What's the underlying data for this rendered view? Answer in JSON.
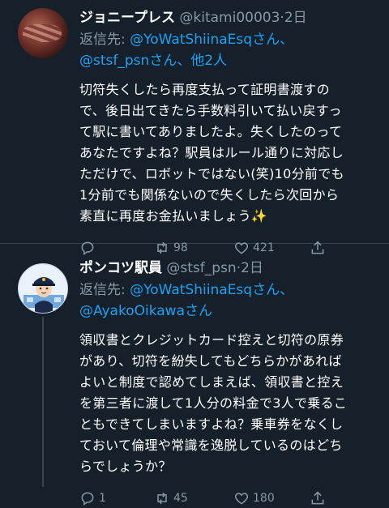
{
  "tweets": [
    {
      "name": "ジョニープレス",
      "handle": "@kitami00003",
      "dot": "·",
      "time": "2日",
      "reply_prefix": "返信先: ",
      "reply_to_1": "@YoWatShiinaEsq",
      "reply_suffix_1": "さん、",
      "reply_to_2": "@stsf_psn",
      "reply_suffix_2": "さん、",
      "reply_others": "他2人",
      "text_lines": [
        "切符失くしたら再度支払って証明書渡すの",
        "で、後日出てきたら手数料引いて払い戻すっ",
        "て駅に書いてありましたよ。失くしたのって",
        "あなたですよね？駅員はルール通りに対応し",
        "ただけで、ロボットではない(笑)10分前でも",
        "1分前でも関係ないので失くしたら次回から",
        "素直に再度お金払いましょう✨"
      ],
      "replies": "",
      "retweets": "98",
      "likes": "421"
    },
    {
      "name": "ポンコツ駅員",
      "handle": "@stsf_psn",
      "dot": "·",
      "time": "2日",
      "reply_prefix": "返信先: ",
      "reply_to_1": "@YoWatShiinaEsq",
      "reply_suffix_1": "さん、",
      "reply_to_2": "@AyakoOikawa",
      "reply_suffix_2": "さん",
      "text_lines": [
        "領収書とクレジットカード控えと切符の原券",
        "があり、切符を紛失してもどちらかがあれば",
        "よいと制度で認めてしまえば、領収書と控え",
        "を第三者に渡して1人分の料金で3人で乗るこ",
        "ともできてしまいますよね？乗車券をなくし",
        "ておいて倫理や常識を逸脱しているのはどち",
        "らでしょうか？"
      ],
      "replies": "1",
      "retweets": "45",
      "likes": "180"
    }
  ]
}
